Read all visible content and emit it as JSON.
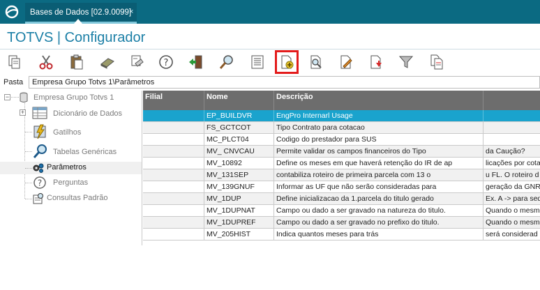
{
  "tab": {
    "label": "Bases de Dados [02.9.0099]",
    "close": "×"
  },
  "app_title": "TOTVS | Configurador",
  "toolbar": {
    "buttons": [
      {
        "name": "copy-icon"
      },
      {
        "name": "cut-icon"
      },
      {
        "name": "paste-icon"
      },
      {
        "name": "eraser-icon"
      },
      {
        "name": "print-icon"
      },
      {
        "name": "help-icon"
      },
      {
        "name": "exit-icon"
      },
      {
        "name": "search-icon"
      },
      {
        "name": "list-icon"
      },
      {
        "name": "new-document-icon",
        "highlighted": true
      },
      {
        "name": "view-document-icon"
      },
      {
        "name": "edit-document-icon"
      },
      {
        "name": "delete-document-icon"
      },
      {
        "name": "filter-icon"
      },
      {
        "name": "copy-document-icon"
      }
    ]
  },
  "path": {
    "label": "Pasta",
    "value": "Empresa Grupo Totvs 1\\Parâmetros"
  },
  "tree": {
    "root": "Empresa Grupo Totvs 1",
    "items": [
      {
        "label": "Dicionário de Dados",
        "icon": "table-icon"
      },
      {
        "label": "Gatilhos",
        "icon": "trigger-icon"
      },
      {
        "label": "Tabelas Genéricas",
        "icon": "magnifier-icon"
      },
      {
        "label": "Parâmetros",
        "icon": "gears-icon",
        "selected": true
      },
      {
        "label": "Perguntas",
        "icon": "question-icon"
      },
      {
        "label": "Consultas Padrão",
        "icon": "query-icon"
      }
    ]
  },
  "grid": {
    "headers": [
      "Filial",
      "Nome",
      "Descrição",
      ""
    ],
    "rows": [
      [
        "",
        "EP_BUILDVR",
        "EngPro Internarl Usage",
        ""
      ],
      [
        "",
        "FS_GCTCOT",
        "Tipo Contrato para cotacao",
        ""
      ],
      [
        "",
        "MC_PLCT04",
        "Codigo do prestador para SUS",
        ""
      ],
      [
        "",
        "MV_ CNVCAU",
        "Permite validar os campos financeiros do Tipo",
        "da Caução?"
      ],
      [
        "",
        "MV_10892",
        "Define os meses em que haverá retenção do IR de ap",
        "licações por cota"
      ],
      [
        "",
        "MV_131SEP",
        "contabiliza roteiro de primeira parcela com 13 o",
        "u FL. O roteiro d"
      ],
      [
        "",
        "MV_139GNUF",
        "Informar as UF que não serão consideradas para",
        "geração da GNR"
      ],
      [
        "",
        "MV_1DUP",
        "Define inicializacao da 1.parcela do titulo gerado",
        "Ex. A -> para seq"
      ],
      [
        "",
        "MV_1DUPNAT",
        "Campo ou dado a ser gravado na natureza do titulo.",
        "Quando o mesm"
      ],
      [
        "",
        "MV_1DUPREF",
        "Campo ou dado a ser gravado no prefixo do titulo.",
        "Quando o mesm"
      ],
      [
        "",
        "MV_205HIST",
        "Indica quantos meses para trás",
        "será considerad"
      ]
    ],
    "selected_row": 0
  },
  "colors": {
    "topbar": "#0b6a82",
    "title": "#1b7fa6",
    "selection": "#1aa3cd",
    "grid_header": "#6d6d6d",
    "highlight": "#e31b1b"
  }
}
